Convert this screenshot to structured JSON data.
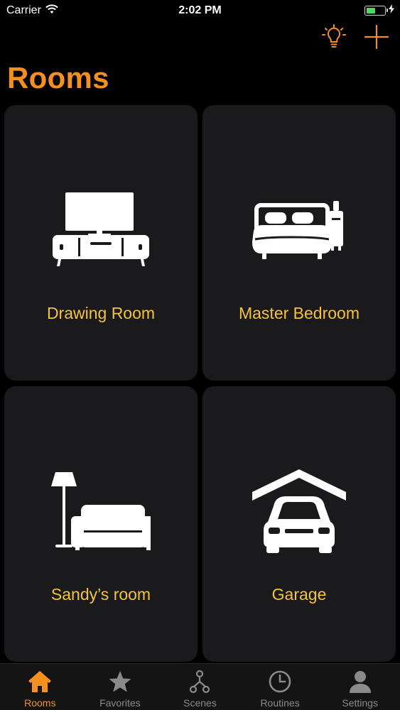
{
  "status_bar": {
    "carrier": "Carrier",
    "time": "2:02 PM",
    "battery_level": 0.5
  },
  "colors": {
    "accent": "#f5901e",
    "room_label": "#f5c33a",
    "card_bg": "#1a1a1c",
    "tab_inactive": "#8a8a8a",
    "battery_fill": "#4cd964"
  },
  "header": {
    "title": "Rooms",
    "actions": [
      {
        "icon": "lightbulb-icon"
      },
      {
        "icon": "plus-icon"
      }
    ]
  },
  "rooms": [
    {
      "name": "Drawing Room",
      "icon": "tv-stand-icon"
    },
    {
      "name": "Master Bedroom",
      "icon": "bed-icon"
    },
    {
      "name": "Sandy’s room",
      "icon": "sofa-lamp-icon"
    },
    {
      "name": "Garage",
      "icon": "garage-car-icon"
    }
  ],
  "tab_bar": {
    "active": "Rooms",
    "tabs": [
      {
        "label": "Rooms",
        "icon": "home-icon"
      },
      {
        "label": "Favorites",
        "icon": "star-icon"
      },
      {
        "label": "Scenes",
        "icon": "scenes-icon"
      },
      {
        "label": "Routines",
        "icon": "clock-icon"
      },
      {
        "label": "Settings",
        "icon": "person-icon"
      }
    ]
  }
}
